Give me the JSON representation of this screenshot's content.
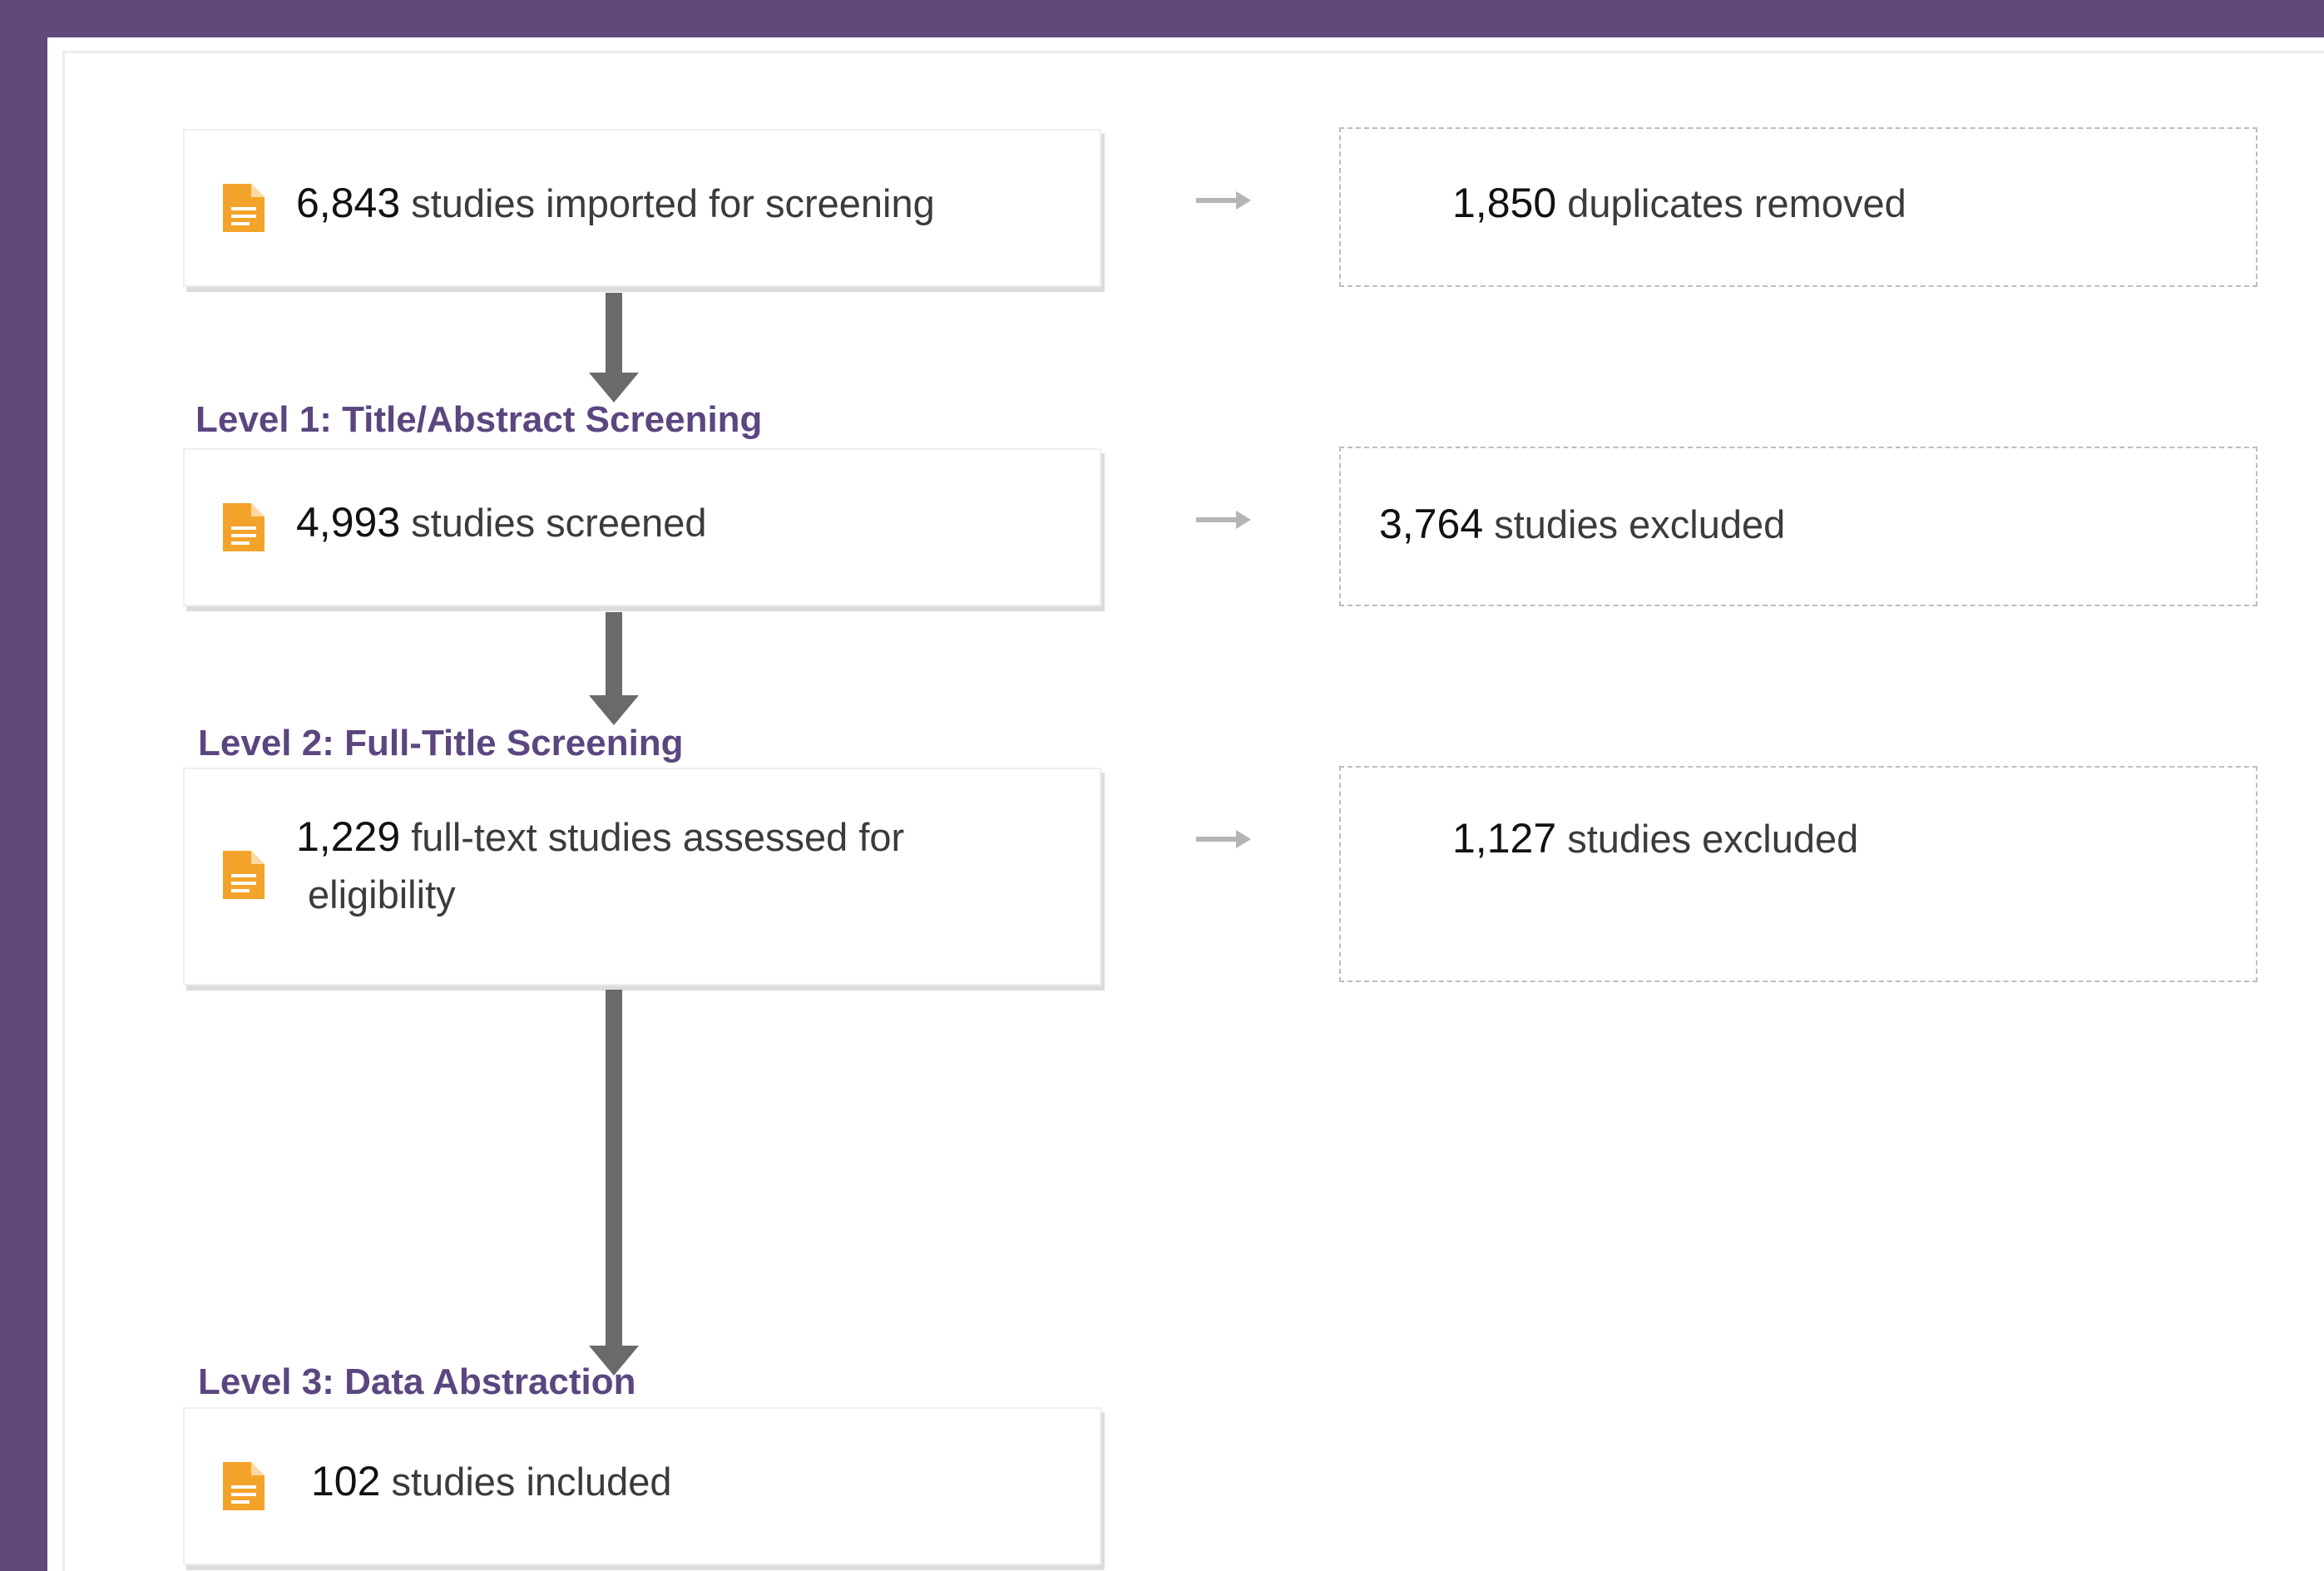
{
  "stages": [
    {
      "count": "6,843",
      "text": "studies imported for screening",
      "icon": "document-icon"
    },
    {
      "count": "4,993",
      "text": "studies screened",
      "icon": "document-icon"
    },
    {
      "count": "1,229",
      "text_line1": "full-text studies assessed for",
      "text_line2": "eligibility",
      "icon": "document-icon"
    },
    {
      "count": "102",
      "text": "studies included",
      "icon": "document-icon"
    }
  ],
  "exclusions": [
    {
      "count": "1,850",
      "text": "duplicates removed"
    },
    {
      "count": "3,764",
      "text": "studies excluded"
    },
    {
      "count": "1,127",
      "text": "studies excluded"
    }
  ],
  "levels": [
    "Level 1: Title/Abstract Screening",
    "Level 2: Full-Title Screening",
    "Level 3: Data Abstraction"
  ],
  "colors": {
    "frame": "#614a7b",
    "level_label": "#5b4680",
    "document_icon": "#f4a32a",
    "arrow": "#6a6a6a",
    "side_arrow": "#b5b5b5"
  }
}
